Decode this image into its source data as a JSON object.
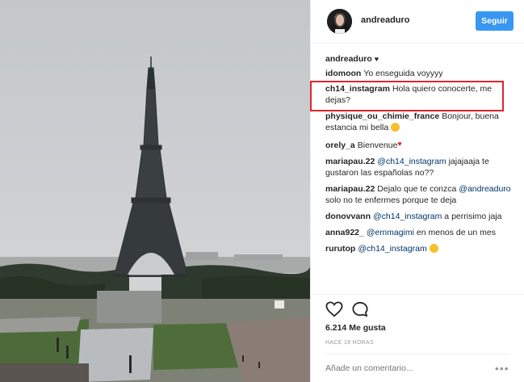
{
  "post": {
    "photo_alt": "Eiffel Tower seen from Trocadéro under an overcast sky",
    "username": "andreaduro",
    "follow_label": "Seguir"
  },
  "comments": [
    {
      "user": "andreaduro",
      "text": "♥"
    },
    {
      "user": "idomoon",
      "text": "Yo enseguida voyyyy"
    },
    {
      "user": "ch14_instagram",
      "text": "Hola quiero conocerte, me dejas?"
    },
    {
      "user": "physique_ou_chimie_france",
      "text": "Bonjour, buena estancia mi bella"
    },
    {
      "user": "orely_a",
      "text": "Bienvenue"
    },
    {
      "user": "mariapau.22",
      "mention": "@ch14_instagram",
      "text": " jajajaaja te gustaron las españolas no??"
    },
    {
      "user": "mariapau.22",
      "text_before": "Dejalo que te conzca ",
      "mention": "@andreaduro",
      "text": " solo no te enfermes porque te deja"
    },
    {
      "user": "donovvann",
      "mention": "@ch14_instagram",
      "text": " a perrisimo jaja"
    },
    {
      "user": "anna922_",
      "mention": "@emmagimi",
      "text": " en menos de un mes"
    },
    {
      "user": "rurutop",
      "mention": "@ch14_instagram",
      "text": ""
    }
  ],
  "actions": {
    "likes": "6.214 Me gusta",
    "time": "HACE 18 HORAS",
    "comment_placeholder": "Añade un comentario...",
    "more_label": "•••"
  },
  "colors": {
    "accent": "#3897f0",
    "highlight": "#e0242b",
    "mention": "#003569"
  }
}
